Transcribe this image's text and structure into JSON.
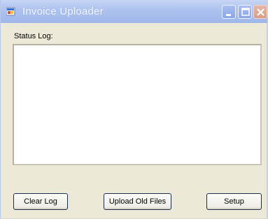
{
  "window": {
    "title": "Invoice Uploader"
  },
  "status": {
    "label": "Status Log:",
    "log_text": ""
  },
  "buttons": {
    "clear_log": "Clear Log",
    "upload_old_files": "Upload Old Files",
    "setup": "Setup"
  },
  "icons": {
    "app": "app-window-icon",
    "minimize": "minimize-icon",
    "maximize": "maximize-icon",
    "close": "close-icon"
  },
  "colors": {
    "titlebar": "#a9bdef",
    "window_bg": "#ece9d8",
    "close_button": "#d99d86"
  }
}
